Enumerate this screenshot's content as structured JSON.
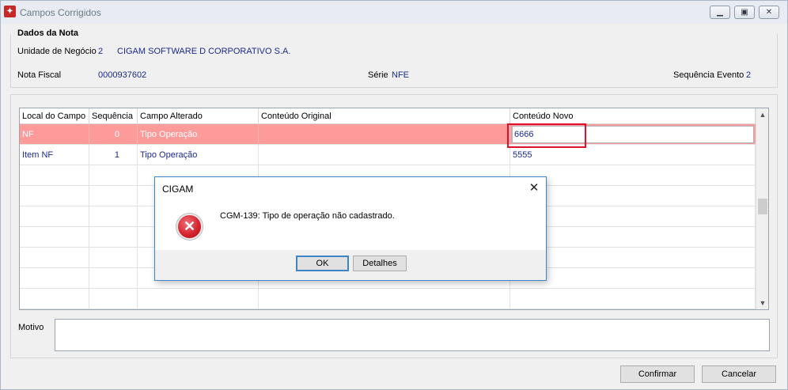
{
  "window": {
    "title": "Campos Corrigidos",
    "controls": [
      "minimize-icon",
      "maximize-icon",
      "close-icon"
    ]
  },
  "nota": {
    "group_title": "Dados da Nota",
    "unidade_label": "Unidade de Negócio",
    "unidade_code": "2",
    "unidade_name": "CIGAM SOFTWARE D CORPORATIVO S.A.",
    "nota_label": "Nota Fiscal",
    "nota_value": "0000937602",
    "serie_label": "Série",
    "serie_value": "NFE",
    "seq_evento_label": "Sequência Evento",
    "seq_evento_value": "2"
  },
  "grid": {
    "headers": [
      "Local do Campo",
      "Sequência",
      "Campo Alterado",
      "Conteúdo Original",
      "Conteúdo Novo"
    ],
    "rows": [
      {
        "local": "NF",
        "sequencia": "0",
        "campo": "Tipo Operação",
        "original": "",
        "novo": "6666",
        "selected": true
      },
      {
        "local": "Item NF",
        "sequencia": "1",
        "campo": "Tipo Operação",
        "original": "",
        "novo": "5555",
        "selected": false
      }
    ],
    "empty_row_count": 7
  },
  "motivo": {
    "label": "Motivo",
    "value": ""
  },
  "buttons": {
    "confirm_label": "Confirmar",
    "cancel_label": "Cancelar"
  },
  "dialog": {
    "title": "CIGAM",
    "message": "CGM-139: Tipo de operação não cadastrado.",
    "ok_label": "OK",
    "details_label": "Detalhes",
    "icon": "error-icon"
  },
  "colors": {
    "selected_row": "#fd9a9a",
    "value_text": "#1a2a8c",
    "highlight_border": "#e0102a"
  }
}
